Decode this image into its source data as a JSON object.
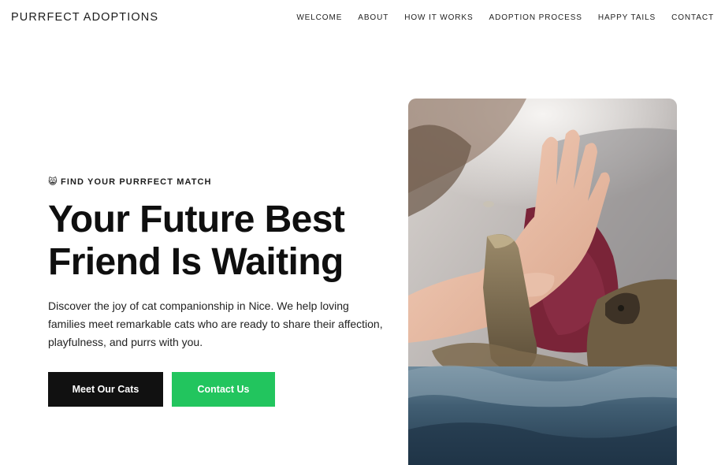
{
  "header": {
    "brand": "PURRFECT ADOPTIONS",
    "nav": [
      "WELCOME",
      "ABOUT",
      "HOW IT WORKS",
      "ADOPTION PROCESS",
      "HAPPY TAILS",
      "CONTACT"
    ]
  },
  "hero": {
    "eyebrow_icon": "😸",
    "eyebrow": "FIND YOUR PURRFECT MATCH",
    "headline_line1": "Your Future Best",
    "headline_line2": "Friend Is Waiting",
    "description": "Discover the joy of cat companionship in Nice. We help loving families meet remarkable cats who are ready to share their affection, playfulness, and purrs with you.",
    "primary_button": "Meet Our Cats",
    "secondary_button": "Contact Us",
    "image_icon": "cat-high-five-photo"
  },
  "colors": {
    "primary_button_bg": "#111111",
    "secondary_button_bg": "#22c55e",
    "text": "#111111"
  }
}
